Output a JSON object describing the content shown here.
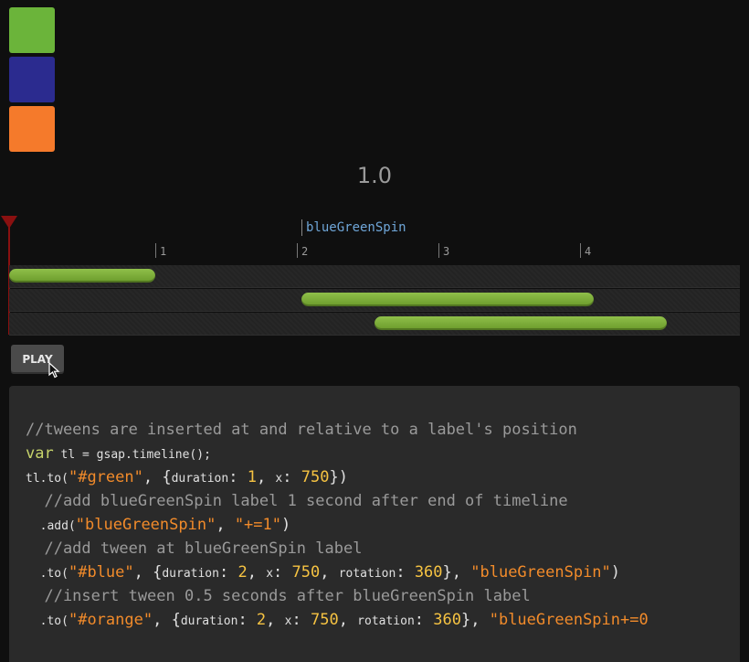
{
  "boxes": {
    "green": {
      "color": "#6bb43a"
    },
    "blue": {
      "color": "#2b2b8f"
    },
    "orange": {
      "color": "#f57a2b"
    }
  },
  "time_readout": "1.0",
  "timeline": {
    "label": "blueGreenSpin",
    "ticks": [
      "1",
      "2",
      "3",
      "4"
    ],
    "duration_seconds": 5,
    "tracks": [
      {
        "target": "green",
        "start": 0,
        "end": 1
      },
      {
        "target": "blue",
        "start": 2,
        "end": 4
      },
      {
        "target": "orange",
        "start": 2.5,
        "end": 4.5
      }
    ],
    "playhead_position": 0
  },
  "play_button": {
    "label": "PLAY"
  },
  "code": {
    "line1_comment": "//tweens are inserted at and relative to a label's position",
    "line2_var": "var",
    "line2_rest": " tl = gsap.timeline();",
    "line3_pre": "tl.to(",
    "line3_target": "\"#green\"",
    "line3_mid1": ", {",
    "line3_key1": "duration",
    "line3_sep1": ": ",
    "line3_val1": "1",
    "line3_sep2": ", ",
    "line3_key2": "x",
    "line3_sep3": ": ",
    "line3_val2": "750",
    "line3_end": "})",
    "line4_comment": "  //add blueGreenSpin label 1 second after end of timeline",
    "line5_pre": "  .add(",
    "line5_label": "\"blueGreenSpin\"",
    "line5_sep": ", ",
    "line5_offset": "\"+=1\"",
    "line5_end": ")",
    "line6_comment": "  //add tween at blueGreenSpin label",
    "line7_pre": "  .to(",
    "line7_target": "\"#blue\"",
    "line7_mid1": ", {",
    "line7_key1": "duration",
    "line7_sep1": ": ",
    "line7_val1": "2",
    "line7_sep2": ", ",
    "line7_key2": "x",
    "line7_sep3": ": ",
    "line7_val2": "750",
    "line7_sep4": ", ",
    "line7_key3": "rotation",
    "line7_sep5": ": ",
    "line7_val3": "360",
    "line7_mid2": "}, ",
    "line7_label": "\"blueGreenSpin\"",
    "line7_end": ")",
    "line8_comment": "  //insert tween 0.5 seconds after blueGreenSpin label",
    "line9_pre": "  .to(",
    "line9_target": "\"#orange\"",
    "line9_mid1": ", {",
    "line9_key1": "duration",
    "line9_sep1": ": ",
    "line9_val1": "2",
    "line9_sep2": ", ",
    "line9_key2": "x",
    "line9_sep3": ": ",
    "line9_val2": "750",
    "line9_sep4": ", ",
    "line9_key3": "rotation",
    "line9_sep5": ": ",
    "line9_val3": "360",
    "line9_mid2": "}, ",
    "line9_label": "\"blueGreenSpin+=0"
  }
}
